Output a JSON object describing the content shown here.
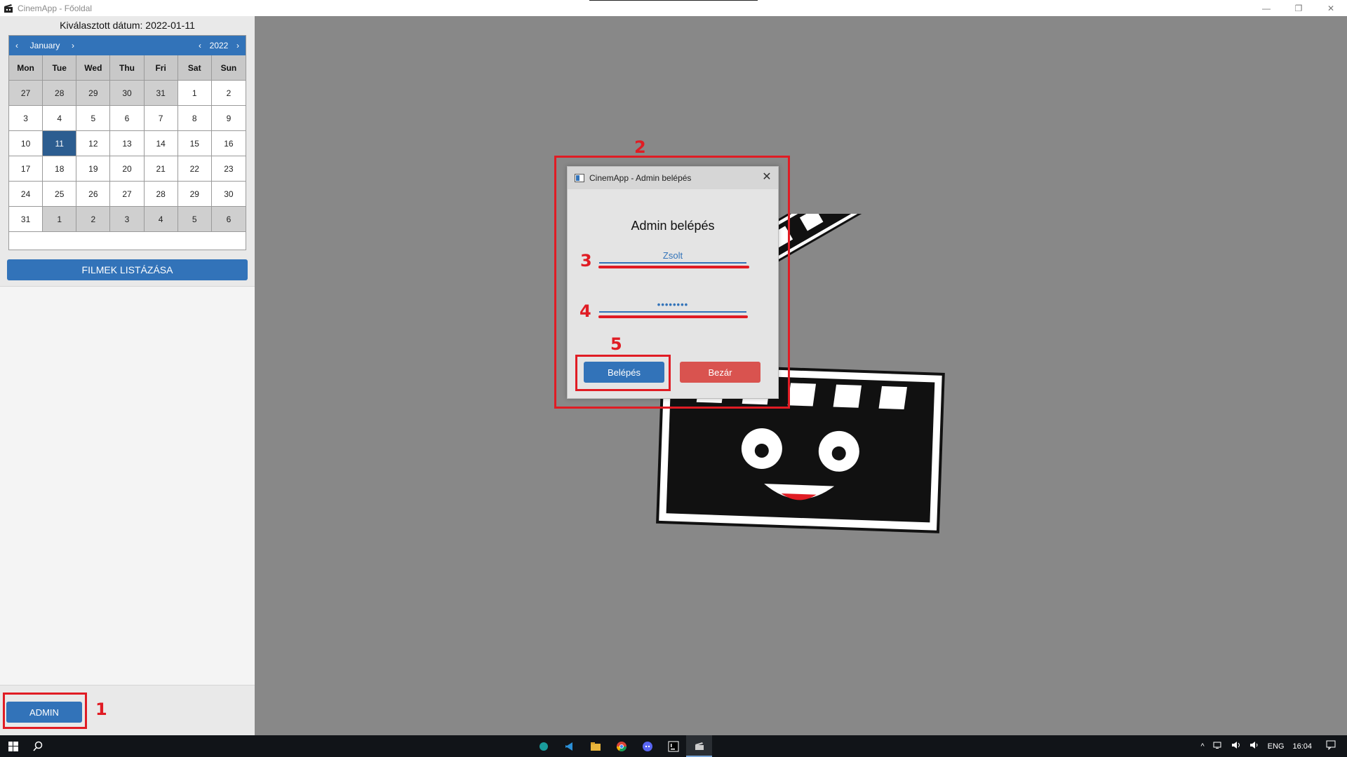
{
  "window": {
    "title": "CinemApp - Főoldal",
    "minimize_glyph": "—",
    "restore_glyph": "❐",
    "close_glyph": "✕"
  },
  "sidebar": {
    "selected_date_text": "Kiválasztott dátum: 2022-01-11",
    "calendar": {
      "month": "January",
      "year": "2022",
      "prev_glyph": "‹",
      "next_glyph": "›",
      "weekdays": [
        "Mon",
        "Tue",
        "Wed",
        "Thu",
        "Fri",
        "Sat",
        "Sun"
      ],
      "days": [
        {
          "d": "27",
          "other": true
        },
        {
          "d": "28",
          "other": true
        },
        {
          "d": "29",
          "other": true
        },
        {
          "d": "30",
          "other": true
        },
        {
          "d": "31",
          "other": true
        },
        {
          "d": "1"
        },
        {
          "d": "2"
        },
        {
          "d": "3"
        },
        {
          "d": "4"
        },
        {
          "d": "5"
        },
        {
          "d": "6"
        },
        {
          "d": "7"
        },
        {
          "d": "8"
        },
        {
          "d": "9"
        },
        {
          "d": "10"
        },
        {
          "d": "11",
          "selected": true
        },
        {
          "d": "12"
        },
        {
          "d": "13"
        },
        {
          "d": "14"
        },
        {
          "d": "15"
        },
        {
          "d": "16"
        },
        {
          "d": "17"
        },
        {
          "d": "18"
        },
        {
          "d": "19"
        },
        {
          "d": "20"
        },
        {
          "d": "21"
        },
        {
          "d": "22"
        },
        {
          "d": "23"
        },
        {
          "d": "24"
        },
        {
          "d": "25"
        },
        {
          "d": "26"
        },
        {
          "d": "27"
        },
        {
          "d": "28"
        },
        {
          "d": "29"
        },
        {
          "d": "30"
        },
        {
          "d": "31"
        },
        {
          "d": "1",
          "other": true
        },
        {
          "d": "2",
          "other": true
        },
        {
          "d": "3",
          "other": true
        },
        {
          "d": "4",
          "other": true
        },
        {
          "d": "5",
          "other": true
        },
        {
          "d": "6",
          "other": true
        }
      ]
    },
    "list_movies_label": "FILMEK LISTÁZÁSA",
    "admin_label": "ADMIN"
  },
  "dialog": {
    "title": "CinemApp - Admin belépés",
    "close_glyph": "✕",
    "heading": "Admin belépés",
    "username_value": "Zsolt",
    "password_value": "••••••••",
    "login_label": "Belépés",
    "close_label": "Bezár"
  },
  "annotations": {
    "n1": "1",
    "n2": "2",
    "n3": "3",
    "n4": "4",
    "n5": "5"
  },
  "taskbar": {
    "language": "ENG",
    "time": "16:04",
    "tray_chevron": "^"
  },
  "colors": {
    "accent": "#3273b9",
    "danger": "#d9534f",
    "annotation": "#e01c24",
    "background": "#888888"
  }
}
